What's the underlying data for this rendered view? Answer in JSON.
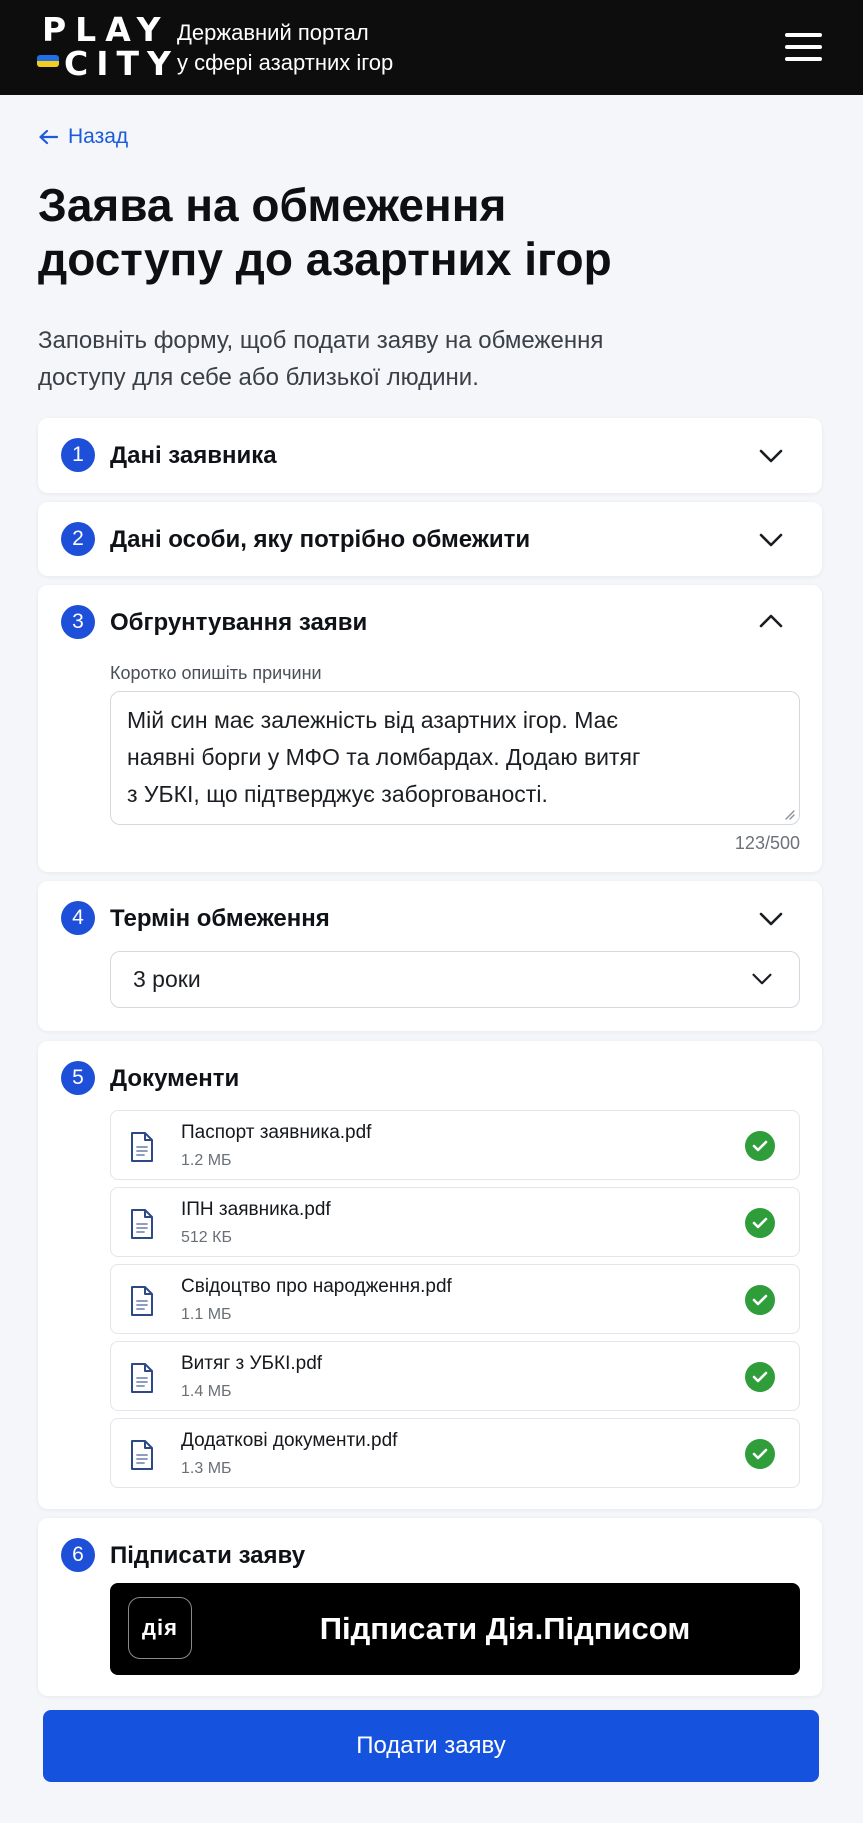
{
  "header": {
    "logo_top": "PLAY",
    "logo_bottom": "CITY",
    "portal_line1": "Державний портал",
    "portal_line2": "у сфері азартних ігор",
    "flag_colors": [
      "#1f6fe6",
      "#f5cc1e"
    ]
  },
  "nav": {
    "back_label": "Назад"
  },
  "page": {
    "title_line1": "Заява на обмеження",
    "title_line2": "доступу до азартних ігор",
    "subtitle_line1": "Заповніть форму, щоб подати заяву на обмеження",
    "subtitle_line2": "доступу для себе або близької людини."
  },
  "steps": [
    {
      "num": "1",
      "title": "Дані заявника",
      "state": "collapsed"
    },
    {
      "num": "2",
      "title": "Дані особи, яку потрібно обмежити",
      "state": "collapsed"
    },
    {
      "num": "3",
      "title": "Обгрунтування заяви",
      "state": "expanded",
      "field_label": "Коротко опишіть причини",
      "text_lines": [
        "Мій син має залежність від азартних ігор. Має",
        "наявні борги у МФО та ломбардах. Додаю витяг",
        "з УБКІ, що підтверджує заборгованості."
      ],
      "counter": "123/500"
    },
    {
      "num": "4",
      "title": "Термін обмеження",
      "state": "collapsed",
      "selected_value": "3 роки"
    },
    {
      "num": "5",
      "title": "Документи",
      "files": [
        {
          "name": "Паспорт заявника.pdf",
          "size": "1.2 МБ"
        },
        {
          "name": "ІПН заявника.pdf",
          "size": "512 КБ"
        },
        {
          "name": "Свідоцтво про народження.pdf",
          "size": "1.1 МБ"
        },
        {
          "name": "Витяг з УБКІ.pdf",
          "size": "1.4 МБ"
        },
        {
          "name": "Додаткові документи.pdf",
          "size": "1.3 МБ"
        }
      ]
    },
    {
      "num": "6",
      "title": "Підписати заяву",
      "sign_logo": "дія",
      "sign_label": "Підписати Дія.Підписом"
    }
  ],
  "submit_label": "Подати заяву",
  "colors": {
    "accent": "#1d4fd8",
    "submit": "#1552dd",
    "success": "#2e9d3a",
    "header_bg": "#0d0d0d"
  },
  "icons": {
    "back": "arrow-left-icon",
    "menu": "hamburger-icon",
    "chevron": "chevron-down-icon",
    "file": "document-icon",
    "success": "check-circle-icon"
  }
}
